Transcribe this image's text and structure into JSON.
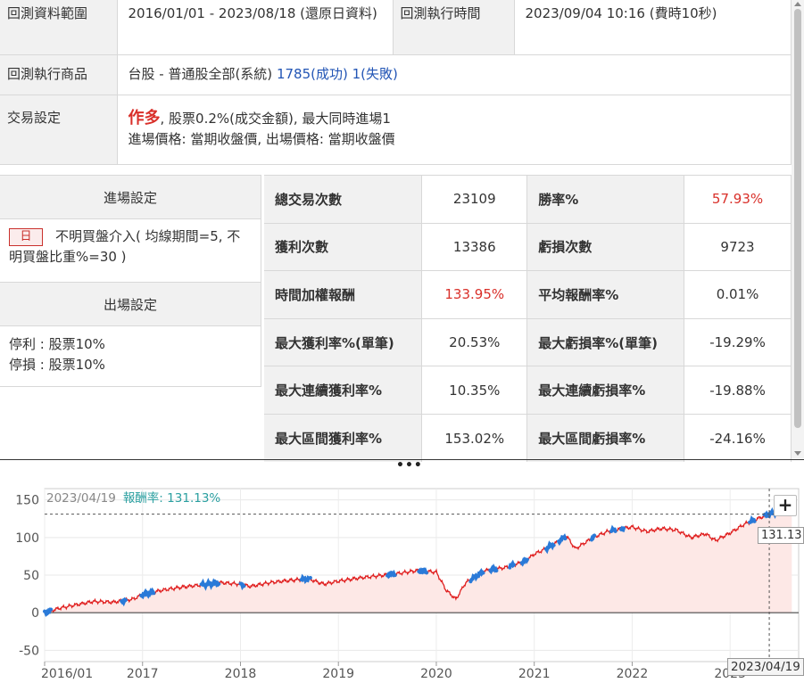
{
  "info": {
    "range_label": "回測資料範圍",
    "range_value": "2016/01/01 - 2023/08/18 (還原日資料)",
    "exec_time_label": "回測執行時間",
    "exec_time_value": "2023/09/04 10:16 (費時10秒)",
    "product_label": "回測執行商品",
    "product_value": "台股 - 普通股全部(系統)",
    "product_success": "1785(成功)",
    "product_fail": "1(失敗)",
    "trade_label": "交易設定",
    "trade_direction": "作多",
    "trade_fee": ", 股票0.2%(成交金額), 最大同時進場1",
    "trade_prices": "進場價格: 當期收盤價, 出場價格: 當期收盤價"
  },
  "settings": {
    "entry_title": "進場設定",
    "entry_badge": "日",
    "entry_text": "不明買盤介入( 均線期間=5, 不明買盤比重%=30 )",
    "exit_title": "出場設定",
    "exit_take_profit": "停利 : 股票10%",
    "exit_stop_loss": "停損 : 股票10%"
  },
  "stats": {
    "rows": [
      {
        "l1": "總交易次數",
        "v1": "23109",
        "l2": "勝率%",
        "v2": "57.93%"
      },
      {
        "l1": "獲利次數",
        "v1": "13386",
        "l2": "虧損次數",
        "v2": "9723"
      },
      {
        "l1": "時間加權報酬",
        "v1": "133.95%",
        "l2": "平均報酬率%",
        "v2": "0.01%"
      },
      {
        "l1": "最大獲利率%(單筆)",
        "v1": "20.53%",
        "l2": "最大虧損率%(單筆)",
        "v2": "-19.29%"
      },
      {
        "l1": "最大連續獲利率%",
        "v1": "10.35%",
        "l2": "最大連續虧損率%",
        "v2": "-19.88%"
      },
      {
        "l1": "最大區間獲利率%",
        "v1": "153.02%",
        "l2": "最大區間虧損率%",
        "v2": "-24.16%"
      }
    ]
  },
  "colors": {
    "up": "#d9302a",
    "link": "#2255b5",
    "line": "#e02020",
    "highlight": "#2a7ad8",
    "fill": "#fde8e6",
    "legend_label": "#2a9fa0"
  },
  "chart_legend": {
    "date": "2023/04/19",
    "label": "報酬率:",
    "value": "131.13%"
  },
  "chart_controls": {
    "plus": "+",
    "last_value": "131.13",
    "cursor_date": "2023/04/19"
  },
  "chart_data": {
    "type": "line",
    "xlabel": "",
    "ylabel": "",
    "x_ticks": [
      "2016/01",
      "2017",
      "2018",
      "2019",
      "2020",
      "2021",
      "2022",
      "2023"
    ],
    "y_ticks": [
      150,
      100,
      50,
      0,
      -50
    ],
    "ylim": [
      -65,
      165
    ],
    "xlim": [
      2016.0,
      2023.7
    ],
    "grid": true,
    "series": [
      {
        "x": [
          2016.0,
          2016.15,
          2016.3,
          2016.5,
          2016.7,
          2016.9,
          2017.0,
          2017.2,
          2017.4,
          2017.6,
          2017.8,
          2018.0,
          2018.1,
          2018.3,
          2018.5,
          2018.7,
          2018.85,
          2019.0,
          2019.2,
          2019.4,
          2019.6,
          2019.8,
          2020.0,
          2020.1,
          2020.2,
          2020.3,
          2020.5,
          2020.7,
          2020.9,
          2021.0,
          2021.1,
          2021.25,
          2021.33,
          2021.42,
          2021.6,
          2021.75,
          2021.9,
          2022.0,
          2022.15,
          2022.3,
          2022.45,
          2022.6,
          2022.75,
          2022.85,
          2023.0,
          2023.15,
          2023.3,
          2023.4,
          2023.5,
          2023.6,
          2023.63
        ],
        "y": [
          0,
          6,
          10,
          15,
          14,
          18,
          24,
          30,
          34,
          37,
          40,
          38,
          35,
          40,
          43,
          45,
          38,
          42,
          46,
          49,
          52,
          56,
          54,
          30,
          18,
          40,
          56,
          60,
          68,
          78,
          84,
          95,
          102,
          85,
          100,
          108,
          112,
          114,
          108,
          112,
          110,
          100,
          105,
          96,
          106,
          118,
          126,
          131,
          135,
          140,
          137
        ],
        "highlight_ranges": [
          [
            2016.0,
            2016.07
          ],
          [
            2016.78,
            2016.83
          ],
          [
            2016.98,
            2017.12
          ],
          [
            2017.6,
            2017.78
          ],
          [
            2018.0,
            2018.04
          ],
          [
            2018.62,
            2018.72
          ],
          [
            2019.5,
            2019.58
          ],
          [
            2019.82,
            2019.9
          ],
          [
            2020.35,
            2020.48
          ],
          [
            2020.55,
            2020.62
          ],
          [
            2020.75,
            2020.8
          ],
          [
            2020.87,
            2020.93
          ],
          [
            2021.12,
            2021.2
          ],
          [
            2021.25,
            2021.32
          ],
          [
            2021.58,
            2021.62
          ],
          [
            2021.78,
            2021.83
          ],
          [
            2021.88,
            2021.92
          ],
          [
            2023.2,
            2023.25
          ],
          [
            2023.35,
            2023.48
          ],
          [
            2023.58,
            2023.62
          ]
        ]
      }
    ]
  }
}
